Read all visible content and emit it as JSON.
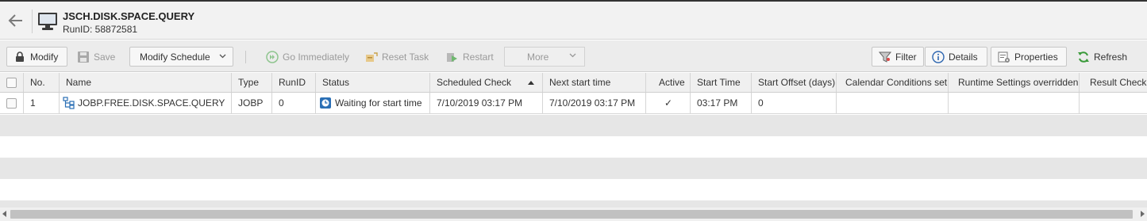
{
  "header": {
    "title": "JSCH.DISK.SPACE.QUERY",
    "subtitle": "RunID: 58872581"
  },
  "toolbar": {
    "modify": "Modify",
    "save": "Save",
    "modify_schedule": "Modify Schedule",
    "go_immediately": "Go Immediately",
    "reset_task": "Reset Task",
    "restart": "Restart",
    "more": "More",
    "filter": "Filter",
    "details": "Details",
    "properties": "Properties",
    "refresh": "Refresh"
  },
  "table": {
    "columns": [
      "No.",
      "Name",
      "Type",
      "RunID",
      "Status",
      "Scheduled Check",
      "Next start time",
      "Active",
      "Start Time",
      "Start Offset (days)",
      "Calendar Conditions set",
      "Runtime Settings overridden",
      "Result Check"
    ],
    "rows": [
      {
        "no": "1",
        "name": "JOBP.FREE.DISK.SPACE.QUERY",
        "type": "JOBP",
        "runid": "0",
        "status": "Waiting for start time",
        "scheduled_check": "7/10/2019 03:17 PM",
        "next_start_time": "7/10/2019 03:17 PM",
        "active": "✓",
        "start_time": "03:17 PM",
        "start_offset": "0",
        "calendar_conditions": "",
        "runtime_overridden": "",
        "result_check": ""
      }
    ]
  },
  "icons": {
    "back": "arrow-left-icon",
    "object": "monitor-icon",
    "modify": "lock-icon",
    "save": "floppy-disk-icon",
    "go_immediately": "fast-forward-icon",
    "reset_task": "reset-icon",
    "restart": "restart-icon",
    "filter": "funnel-icon",
    "details": "info-icon",
    "properties": "properties-icon",
    "refresh": "refresh-icon",
    "job_plan": "workflow-icon",
    "status": "clock-icon"
  },
  "colors": {
    "accent_green": "#3a9a3a",
    "status_blue": "#2a6fb5",
    "info_blue": "#2e66b0"
  }
}
